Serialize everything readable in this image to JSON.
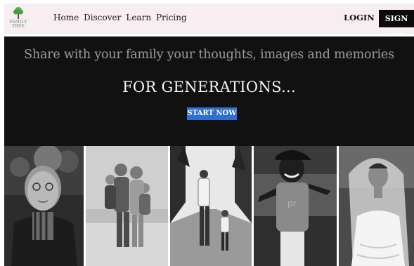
{
  "brand": {
    "logo_line1": "FAMILY",
    "logo_line2": "TREE",
    "logo_icon": "tree-icon",
    "logo_color": "#4caf50"
  },
  "nav": {
    "items": [
      "Home",
      "Discover",
      "Learn",
      "Pricing"
    ],
    "login_label": "LOGIN",
    "signup_label": "SIGN UP"
  },
  "hero": {
    "tagline": "Share with your family your thoughts, images and memories",
    "headline": "FOR GENERATIONS...",
    "cta_label": "START NOW",
    "cta_color": "#2f6fd0"
  },
  "gallery": {
    "photos": [
      "elderly-woman-portrait",
      "family-group-photo",
      "father-and-child-walking",
      "smiling-boy-in-cap",
      "bride-with-veil"
    ]
  }
}
